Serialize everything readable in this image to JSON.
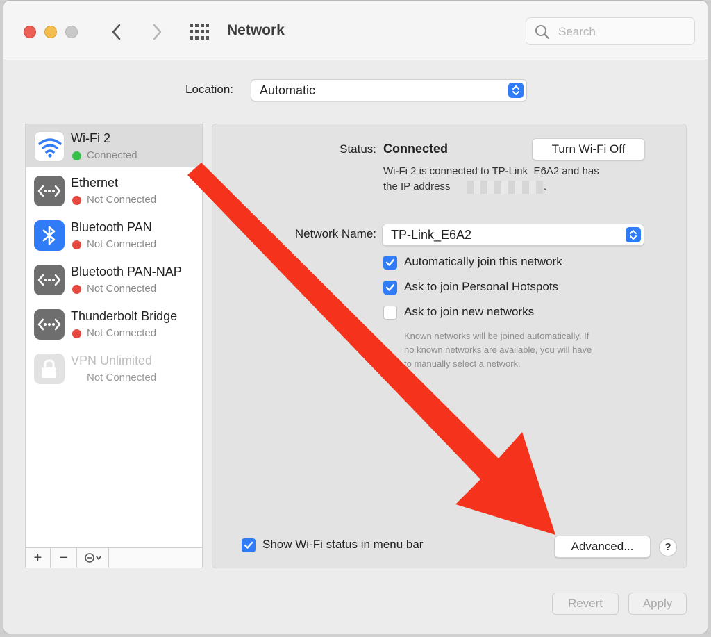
{
  "window": {
    "title": "Network",
    "search_placeholder": "Search"
  },
  "location": {
    "label": "Location:",
    "value": "Automatic"
  },
  "services": [
    {
      "name": "Wi-Fi 2",
      "status": "Connected",
      "status_color": "#34c048",
      "icon": "wifi-icon",
      "selected": true
    },
    {
      "name": "Ethernet",
      "status": "Not Connected",
      "status_color": "#e5463d",
      "icon": "ethernet-icon"
    },
    {
      "name": "Bluetooth PAN",
      "status": "Not Connected",
      "status_color": "#e5463d",
      "icon": "bluetooth-icon"
    },
    {
      "name": "Bluetooth PAN-NAP",
      "status": "Not Connected",
      "status_color": "#e5463d",
      "icon": "ethernet-icon"
    },
    {
      "name": "Thunderbolt Bridge",
      "status": "Not Connected",
      "status_color": "#e5463d",
      "icon": "ethernet-icon"
    },
    {
      "name": "VPN Unlimited",
      "status": "Not Connected",
      "icon": "lock-icon",
      "disabled": true
    }
  ],
  "sidebar_tools": {
    "add": "+",
    "remove": "−"
  },
  "detail": {
    "status_label": "Status:",
    "status_value": "Connected",
    "turn_off_button": "Turn Wi-Fi Off",
    "status_desc_line1": "Wi-Fi 2 is connected to TP-Link_E6A2 and has",
    "status_desc_line2": "the IP address",
    "status_desc_end": ".",
    "network_name_label": "Network Name:",
    "network_name_value": "TP-Link_E6A2",
    "options": [
      {
        "label": "Automatically join this network",
        "checked": true
      },
      {
        "label": "Ask to join Personal Hotspots",
        "checked": true
      },
      {
        "label": "Ask to join new networks",
        "checked": false
      }
    ],
    "note_line1": "Known networks will be joined automatically. If",
    "note_line2": "no known networks are available, you will have",
    "note_line3": "to manually select a network.",
    "show_status_label": "Show Wi-Fi status in menu bar",
    "show_status_checked": true,
    "advanced_button": "Advanced...",
    "help_button": "?"
  },
  "footer": {
    "revert": "Revert",
    "apply": "Apply"
  },
  "colors": {
    "accent": "#2f7cf6",
    "annotation_arrow": "#f5321c"
  }
}
